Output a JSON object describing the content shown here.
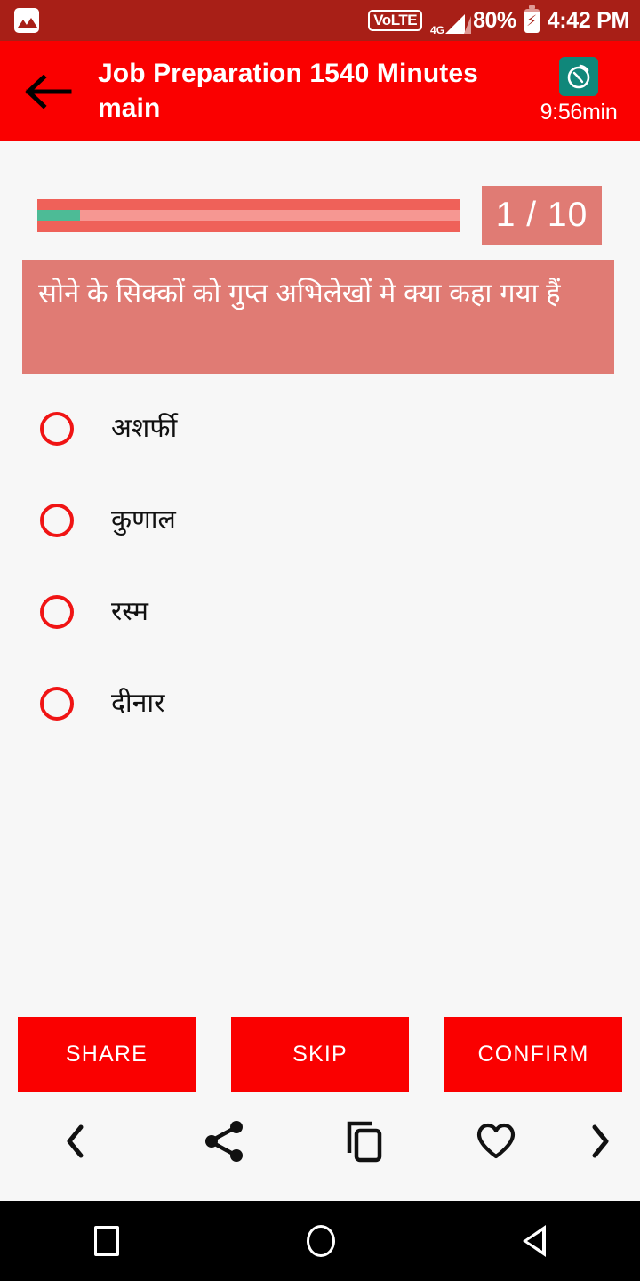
{
  "status_bar": {
    "notification_icon": "photo-icon",
    "volte_label": "VoLTE",
    "network_type": "4G",
    "battery_percent": "80%",
    "clock": "4:42 PM",
    "background_color": "#a81f17"
  },
  "app_bar": {
    "back_icon": "arrow-left-icon",
    "title": "Job Preparation 1540 Minutes main",
    "timer_icon": "stopwatch-icon",
    "timer_text": "9:56min",
    "background_color": "#fa0000",
    "timer_icon_color": "#10877a"
  },
  "progress": {
    "value_percent": 10,
    "fill_color": "#4dbb96",
    "track_color": "#f69792",
    "bar_background_color": "#ef6159",
    "counter_text": "1 / 10",
    "counter_background_color": "#e07b74"
  },
  "question": {
    "text": "सोने के सिक्कों को गुप्त अभिलेखों मे क्या कहा गया हैं",
    "background_color": "#e07b74"
  },
  "options": [
    {
      "label": "अशर्फी",
      "selected": false
    },
    {
      "label": "कुणाल",
      "selected": false
    },
    {
      "label": "रस्म",
      "selected": false
    },
    {
      "label": "दीनार",
      "selected": false
    }
  ],
  "actions": {
    "share_label": "SHARE",
    "skip_label": "SKIP",
    "confirm_label": "CONFIRM",
    "button_color": "#fa0000"
  },
  "icon_bar": {
    "prev_icon": "chevron-left-icon",
    "share_icon": "share-icon",
    "copy_icon": "copy-icon",
    "favorite_icon": "heart-icon",
    "next_icon": "chevron-right-icon"
  },
  "nav_bar": {
    "recents_icon": "square-icon",
    "home_icon": "circle-icon",
    "back_icon": "triangle-back-icon"
  }
}
